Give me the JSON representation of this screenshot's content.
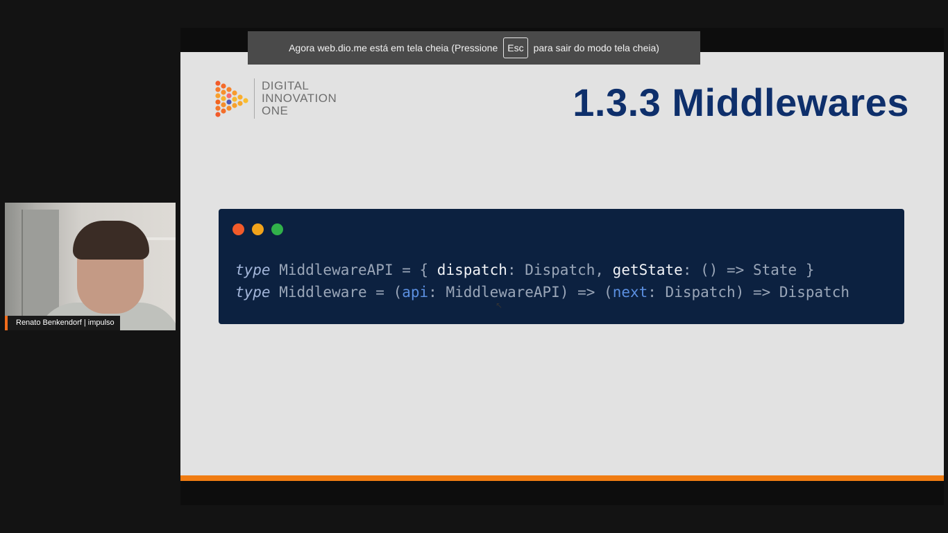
{
  "fullscreen_notice": {
    "text_before": "Agora web.dio.me está em tela cheia (Pressione",
    "key": "Esc",
    "text_after": "para sair do modo tela cheia)"
  },
  "slide": {
    "logo_lines": [
      "DIGITAL",
      "INNOVATION",
      "ONE"
    ],
    "title": "1.3.3 Middlewares",
    "code_window_dot_colors": [
      "#f25b2a",
      "#f2a31b",
      "#31b14a"
    ],
    "code": {
      "line1": {
        "kw": "type",
        "name": " MiddlewareAPI = { ",
        "prop1": "dispatch",
        "t1": ": Dispatch, ",
        "prop2": "getState",
        "t2": ": () => State }"
      },
      "line2": {
        "kw": "type",
        "name": " Middleware = (",
        "p1": "api",
        "t1": ": MiddlewareAPI) => (",
        "p2": "next",
        "t2": ": Dispatch) => Dispatch"
      }
    },
    "accent_color": "#f07c12",
    "title_color": "#0e2f6b"
  },
  "participant": {
    "name": "Renato Benkendorf | impulso"
  }
}
